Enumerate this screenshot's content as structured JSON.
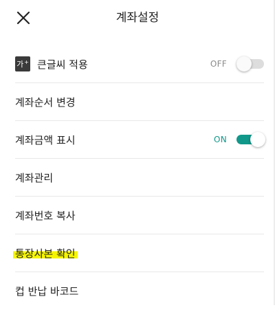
{
  "header": {
    "title": "계좌설정",
    "close_icon": "close-icon"
  },
  "menu": {
    "large_font": {
      "badge_text": "가",
      "badge_sup": "+",
      "label": "큰글씨 적용",
      "state_text": "OFF",
      "enabled": false
    },
    "reorder": {
      "label": "계좌순서 변경"
    },
    "show_amount": {
      "label": "계좌금액 표시",
      "state_text": "ON",
      "enabled": true
    },
    "manage": {
      "label": "계좌관리"
    },
    "copy_number": {
      "label": "계좌번호 복사"
    },
    "passbook": {
      "label": "통장사본 확인"
    },
    "barcode": {
      "label": "컵 반납 바코드"
    }
  },
  "colors": {
    "accent": "#11988a",
    "highlight": "#f6f500",
    "divider": "#e8e8e8"
  }
}
